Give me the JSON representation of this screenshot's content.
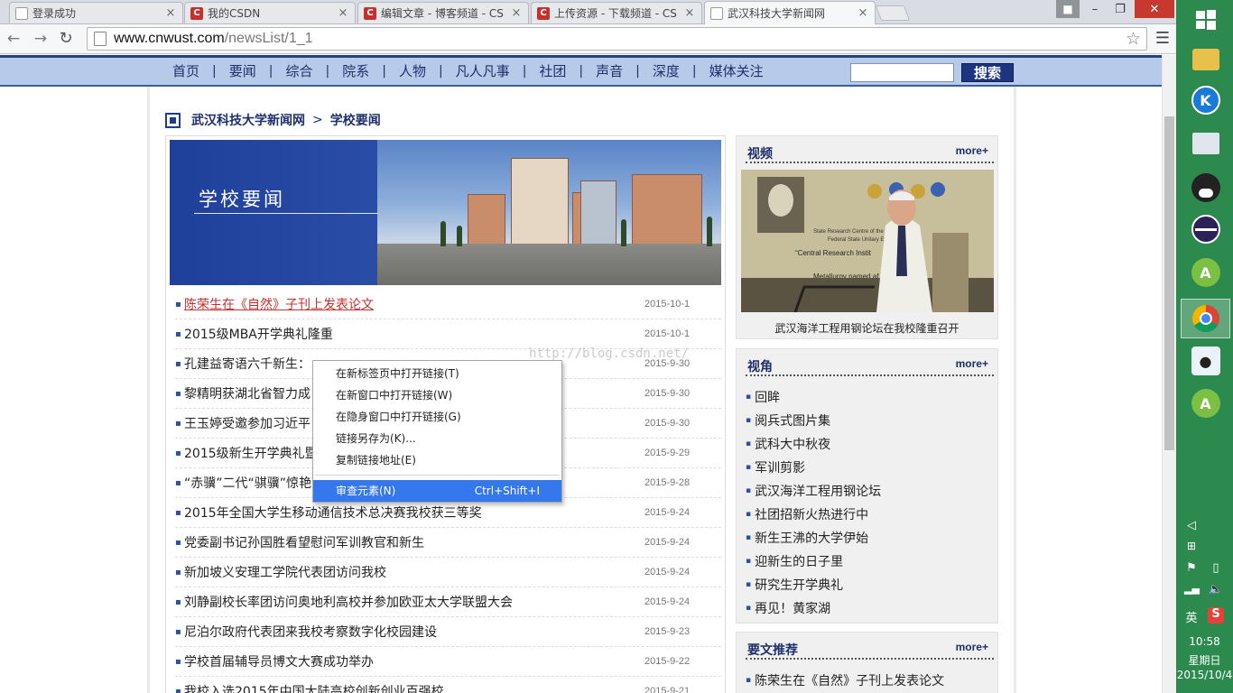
{
  "browser": {
    "tabs": [
      {
        "title": "登录成功",
        "icon": "page-icon"
      },
      {
        "title": "我的CSDN",
        "icon": "csdn-icon"
      },
      {
        "title": "编辑文章 - 博客频道 - CS",
        "icon": "csdn-icon"
      },
      {
        "title": "上传资源 - 下载频道 - CS",
        "icon": "csdn-icon"
      },
      {
        "title": "武汉科技大学新闻网",
        "icon": "page-icon",
        "active": true
      }
    ],
    "url_host": "www.cnwust.com",
    "url_path": "/newsList/1_1"
  },
  "topnav": {
    "items": [
      "首页",
      "要闻",
      "综合",
      "院系",
      "人物",
      "凡人凡事",
      "社团",
      "声音",
      "深度",
      "媒体关注"
    ],
    "search_button": "搜索"
  },
  "breadcrumb": {
    "site": "武汉科技大学新闻网",
    "separator": ">",
    "section": "学校要闻"
  },
  "banner": {
    "title": "学校要闻"
  },
  "news": [
    {
      "title": "陈荣生在《自然》子刊上发表论文",
      "date": "2015-10-1"
    },
    {
      "title": "2015级MBA开学典礼隆重",
      "date": "2015-10-1"
    },
    {
      "title": "孔建益寄语六千新生：",
      "date": "2015-9-30"
    },
    {
      "title": "黎精明获湖北省智力成",
      "date": "2015-9-30"
    },
    {
      "title": "王玉婷受邀参加习近平",
      "date": "2015-9-30"
    },
    {
      "title": "2015级新生开学典礼暨军训总结表彰大会隆重举行",
      "date": "2015-9-29"
    },
    {
      "title": "“赤骥”二代“骐骥”惊艳亮相 孔建益为新车揭幕",
      "date": "2015-9-28"
    },
    {
      "title": "2015年全国大学生移动通信技术总决赛我校获三等奖",
      "date": "2015-9-24"
    },
    {
      "title": "党委副书记孙国胜看望慰问军训教官和新生",
      "date": "2015-9-24"
    },
    {
      "title": "新加坡义安理工学院代表团访问我校",
      "date": "2015-9-24"
    },
    {
      "title": "刘静副校长率团访问奥地利高校并参加欧亚太大学联盟大会",
      "date": "2015-9-24"
    },
    {
      "title": "尼泊尔政府代表团来我校考察数字化校园建设",
      "date": "2015-9-23"
    },
    {
      "title": "学校首届辅导员博文大赛成功举办",
      "date": "2015-9-22"
    },
    {
      "title": "我校入选2015年中国大陆高校创新创业百强校",
      "date": "2015-9-21"
    }
  ],
  "context_menu": {
    "items": [
      {
        "label": "在新标签页中打开链接(T)"
      },
      {
        "label": "在新窗口中打开链接(W)"
      },
      {
        "label": "在隐身窗口中打开链接(G)"
      },
      {
        "label": "链接另存为(K)..."
      },
      {
        "label": "复制链接地址(E)"
      }
    ],
    "inspect": {
      "label": "审查元素(N)",
      "shortcut": "Ctrl+Shift+I"
    }
  },
  "watermark": "http://blog.csdn.net/",
  "sidebar": {
    "video": {
      "title": "视频",
      "more": "more+",
      "caption": "武汉海洋工程用钢论坛在我校隆重召开",
      "slide_text": [
        "State Research Centre of the R",
        "Federal State Unitary E",
        "“Central Research Instit",
        "Metallurgy named af"
      ]
    },
    "angle": {
      "title": "视角",
      "more": "more+",
      "items": [
        "回眸",
        "阅兵式图片集",
        "武科大中秋夜",
        "军训剪影",
        "武汉海洋工程用钢论坛",
        "社团招新火热进行中",
        "新生王沸的大学伊始",
        "迎新生的日子里",
        "研究生开学典礼",
        "再见！黄家湖"
      ]
    },
    "recommend": {
      "title": "要文推荐",
      "more": "more+",
      "items": [
        "陈荣生在《自然》子刊上发表论文"
      ]
    }
  },
  "taskbar": {
    "time": "10:58",
    "day": "星期日",
    "date": "2015/10/4",
    "ime": "英"
  }
}
